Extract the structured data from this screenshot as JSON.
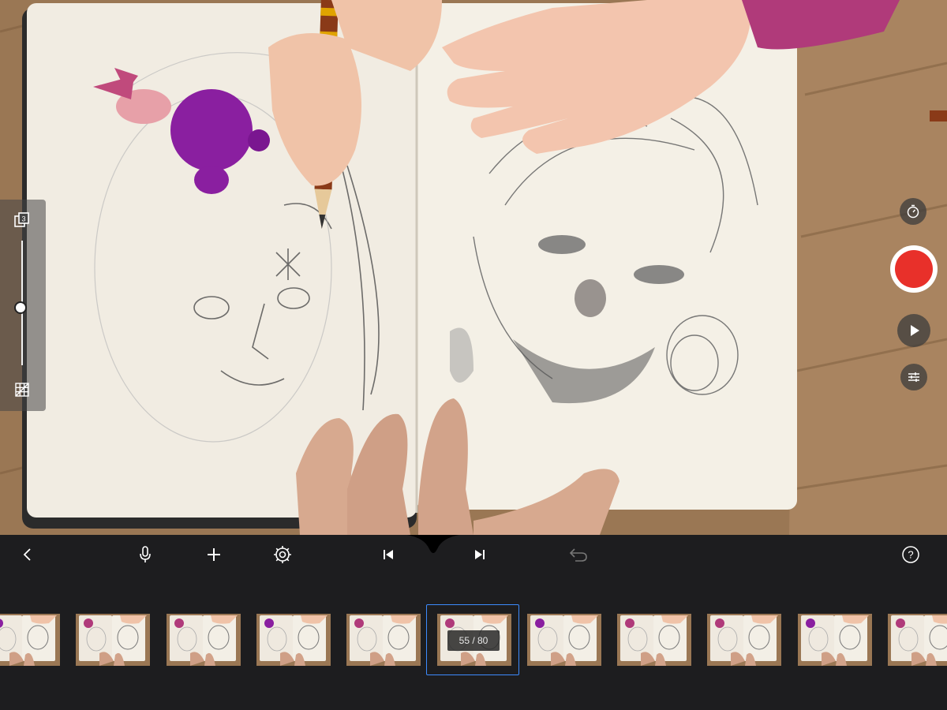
{
  "viewfinder": {
    "scene": "camera-preview"
  },
  "left_panel": {
    "onion_skin_count": "3",
    "opacity_level": 0.5,
    "icons": [
      "onion-skin-layers-icon",
      "grid-overlay-icon"
    ]
  },
  "right_controls": {
    "icons": [
      "timer-icon",
      "record-icon",
      "play-icon",
      "settings-sliders-icon"
    ],
    "record_color": "#e8302a"
  },
  "toolbar": {
    "icons": [
      "back-chevron-icon",
      "microphone-icon",
      "add-icon",
      "settings-gear-icon",
      "skip-previous-icon",
      "skip-next-icon",
      "undo-icon",
      "help-icon"
    ]
  },
  "filmstrip": {
    "counter": "55 / 80",
    "selected_index": 5,
    "frame_count_visible": 11
  },
  "colors": {
    "accent": "#3d8bfd",
    "background": "#1d1d1f"
  }
}
